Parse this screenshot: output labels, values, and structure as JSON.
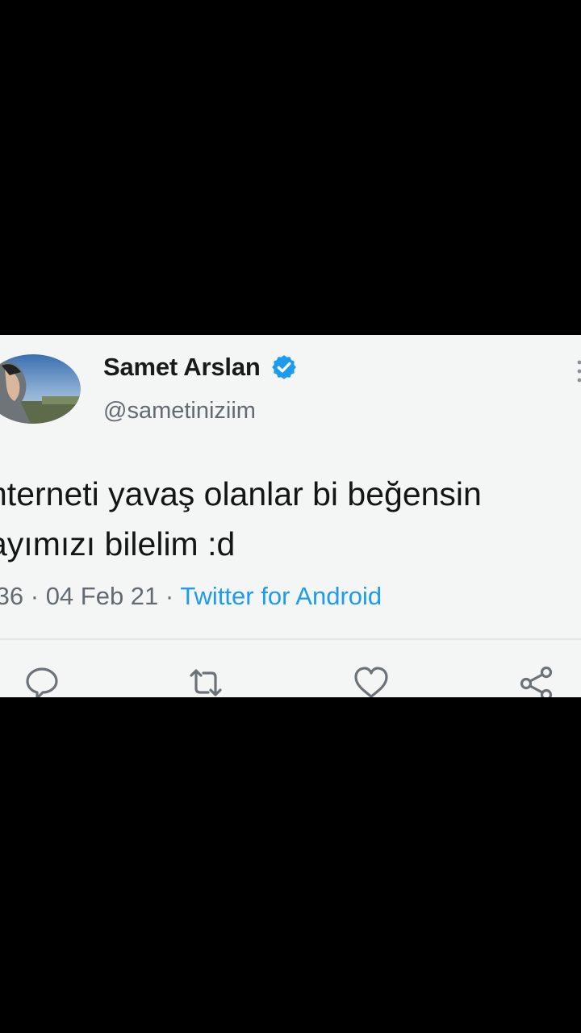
{
  "tweet": {
    "author": {
      "name": "Samet Arslan",
      "handle": "@sametiniziim",
      "verified": true,
      "avatar": "profile-photo"
    },
    "text_lines": [
      "nterneti yavaş olanlar bi beğensin",
      "ayımızı bilelim :d"
    ],
    "time": ":36",
    "separator": "·",
    "date": "04 Feb 21",
    "source": "Twitter for Android"
  },
  "actions": {
    "reply": "reply-icon",
    "retweet": "retweet-icon",
    "like": "heart-icon",
    "share": "share-icon"
  },
  "colors": {
    "background": "#000000",
    "card": "#f4f6f5",
    "text": "#151515",
    "secondary_text": "#636b72",
    "accent": "#1d9bf0"
  }
}
